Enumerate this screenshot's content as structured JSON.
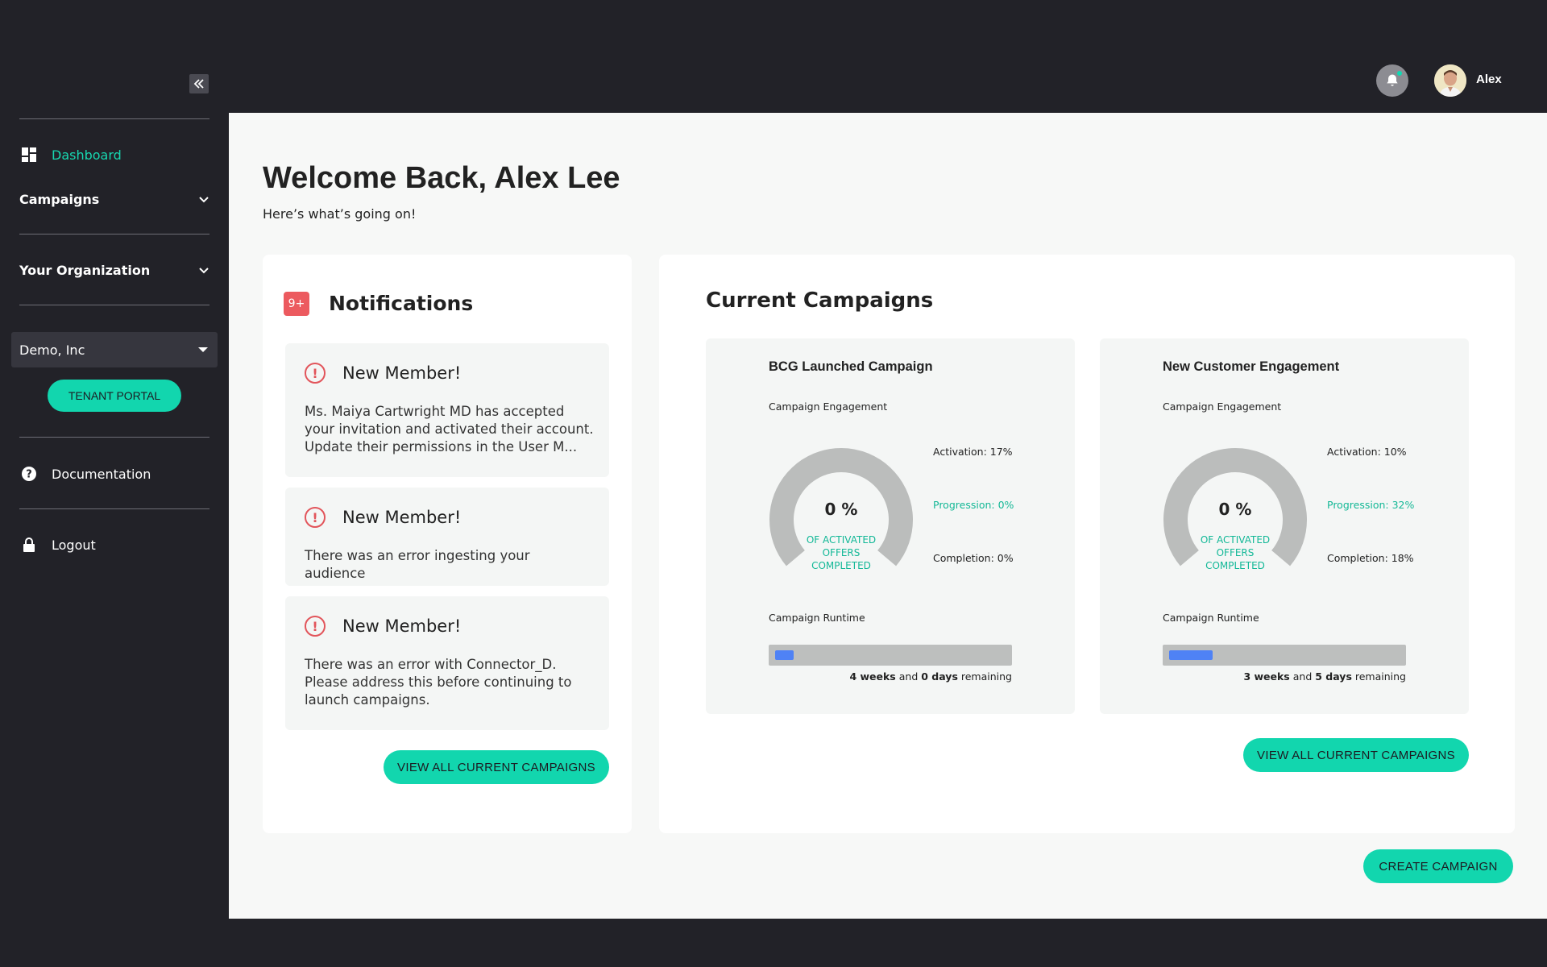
{
  "header": {
    "user_name": "Alex",
    "notification_icon": "bell-icon",
    "avatar_icon": "user-avatar"
  },
  "sidebar": {
    "collapse_icon": "double-chevron-left-icon",
    "items": [
      {
        "label": "Dashboard",
        "icon": "dashboard-icon",
        "active": true
      },
      {
        "label": "Campaigns",
        "icon": "chevron-down-icon"
      },
      {
        "label": "Your Organization",
        "icon": "chevron-down-icon"
      },
      {
        "label": "Documentation",
        "icon": "help-circle-icon"
      },
      {
        "label": "Logout",
        "icon": "lock-icon"
      }
    ],
    "org_select": {
      "value": "Demo, Inc"
    },
    "tenant_portal_label": "TENANT PORTAL"
  },
  "main": {
    "welcome": "Welcome Back, Alex Lee",
    "subtitle": "Here’s what’s going on!",
    "notifications": {
      "badge": "9+",
      "title": "Notifications",
      "items": [
        {
          "title": "New Member!",
          "body": "Ms. Maiya Cartwright MD has accepted your invitation and activated their account. Update their permissions in the User M..."
        },
        {
          "title": "New Member!",
          "body": "There was an error ingesting your audience"
        },
        {
          "title": "New Member!",
          "body": "There was an error with Connector_D. Please address this before continuing to launch campaigns."
        }
      ],
      "button_label": "VIEW ALL CURRENT CAMPAIGNS"
    },
    "campaigns": {
      "title": "Current Campaigns",
      "engagement_label": "Campaign Engagement",
      "runtime_label": "Campaign Runtime",
      "gauge_caption": "OF ACTIVATED OFFERS COMPLETED",
      "and_word": "and",
      "remaining_word": "remaining",
      "items": [
        {
          "name": "BCG Launched Campaign",
          "percent": "0 %",
          "activation": "Activation: 17%",
          "progression": "Progression: 0%",
          "completion": "Completion: 0%",
          "weeks": "4 weeks",
          "days": "0 days",
          "runtime_progress": 0.08
        },
        {
          "name": "New Customer Engagement",
          "percent": "0 %",
          "activation": "Activation: 10%",
          "progression": "Progression: 32%",
          "completion": "Completion: 18%",
          "weeks": "3 weeks",
          "days": "5 days",
          "runtime_progress": 0.19
        }
      ],
      "button_label": "VIEW ALL CURRENT CAMPAIGNS"
    },
    "create_button_label": "CREATE CAMPAIGN"
  },
  "colors": {
    "accent": "#12d6ae",
    "sidebar_bg": "#222228",
    "alert": "#e2555b",
    "progress": "#4f82f5"
  }
}
